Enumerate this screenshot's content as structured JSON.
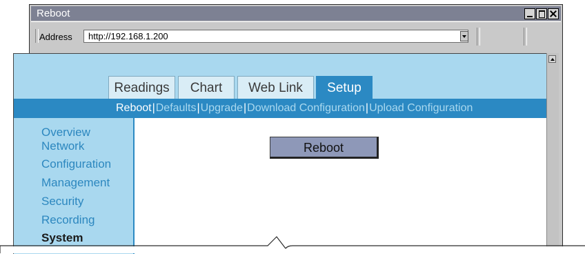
{
  "window": {
    "title": "Reboot"
  },
  "address_bar": {
    "label": "Address",
    "url": "http://192.168.1.200"
  },
  "tabs": [
    {
      "label": "Readings",
      "active": false
    },
    {
      "label": "Chart",
      "active": false
    },
    {
      "label": "Web Link",
      "active": false
    },
    {
      "label": "Setup",
      "active": true
    }
  ],
  "subnav": {
    "items": [
      "Reboot",
      "Defaults",
      "Upgrade",
      "Download Configuration",
      "Upload Configuration"
    ],
    "separator": "|"
  },
  "sidebar": {
    "items": [
      {
        "label": "Overview",
        "current": false
      },
      {
        "label": "Network",
        "current": false
      },
      {
        "label": "Configuration",
        "current": false
      },
      {
        "label": "Management",
        "current": false
      },
      {
        "label": "Security",
        "current": false
      },
      {
        "label": "Recording",
        "current": false
      },
      {
        "label": "System",
        "current": true
      }
    ]
  },
  "main": {
    "reboot_button": "Reboot"
  },
  "colors": {
    "accent": "#2b89c3",
    "page_bg": "#a9d8ef",
    "link": "#2c87bf",
    "button": "#8e98b8",
    "titlebar": "#7d8193"
  }
}
